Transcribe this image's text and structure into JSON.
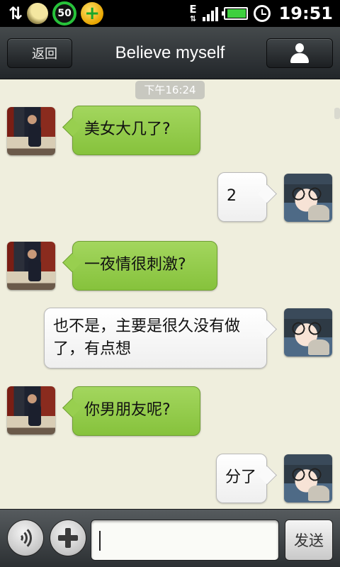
{
  "status_bar": {
    "data_icon": "data-transfer-icon",
    "network_type": "E",
    "battery_ring_value": "50",
    "time": "19:51",
    "battery_level_fraction": 0.85,
    "colors": {
      "ring": "#27c23a",
      "battery": "#3ecf3e"
    }
  },
  "header": {
    "back_label": "返回",
    "title": "Believe myself",
    "profile_icon": "person-icon"
  },
  "chat": {
    "timestamp": "下午16:24",
    "messages": [
      {
        "from": "other",
        "avatar": "avatar-man",
        "text": "美女大几了?"
      },
      {
        "from": "me",
        "avatar": "avatar-girl",
        "text": "2"
      },
      {
        "from": "other",
        "avatar": "avatar-man",
        "text": "一夜情很刺激?"
      },
      {
        "from": "me",
        "avatar": "avatar-girl",
        "text": "也不是，主要是很久没有做了，有点想"
      },
      {
        "from": "other",
        "avatar": "avatar-man",
        "text": "你男朋友呢?"
      },
      {
        "from": "me",
        "avatar": "avatar-girl",
        "text": "分了"
      }
    ],
    "colors": {
      "incoming_bubble": "#98cf4f",
      "outgoing_bubble": "#ffffff",
      "background": "#efeedd"
    }
  },
  "input_bar": {
    "voice_icon": "voice-icon",
    "add_icon": "plus-icon",
    "input_value": "",
    "send_label": "发送"
  }
}
